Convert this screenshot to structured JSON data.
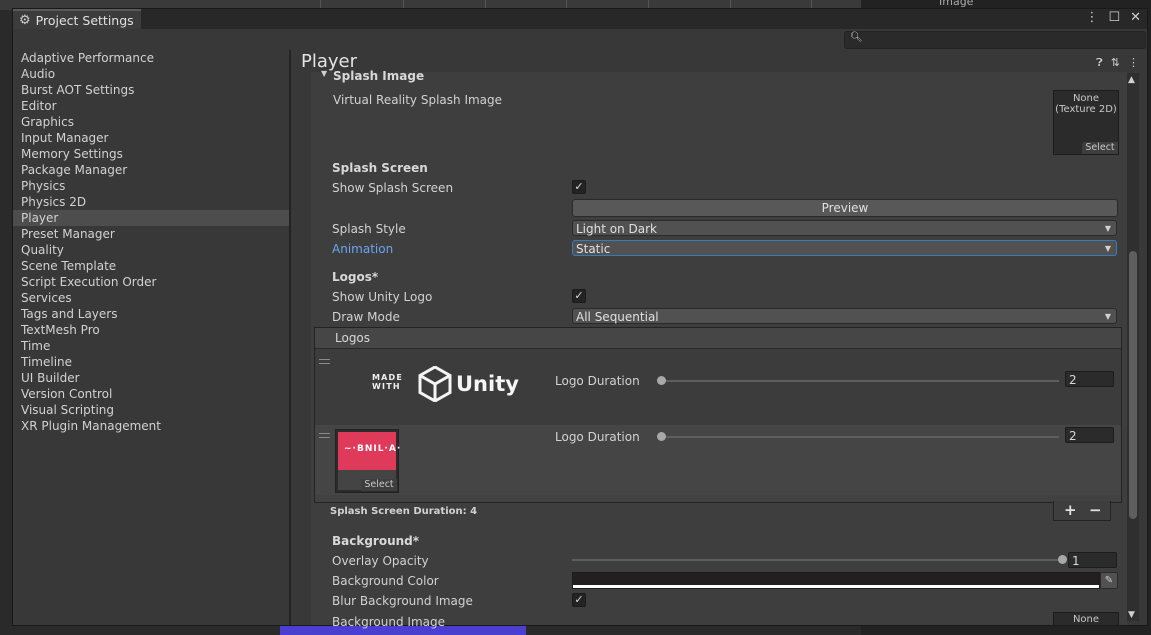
{
  "window": {
    "tab_title": "Project Settings"
  },
  "background_scene": {
    "hierarchy_label": "Image"
  },
  "sidebar": {
    "items": [
      {
        "label": "Adaptive Performance"
      },
      {
        "label": "Audio"
      },
      {
        "label": "Burst AOT Settings"
      },
      {
        "label": "Editor"
      },
      {
        "label": "Graphics"
      },
      {
        "label": "Input Manager"
      },
      {
        "label": "Memory Settings"
      },
      {
        "label": "Package Manager"
      },
      {
        "label": "Physics"
      },
      {
        "label": "Physics 2D"
      },
      {
        "label": "Player",
        "selected": true
      },
      {
        "label": "Preset Manager"
      },
      {
        "label": "Quality"
      },
      {
        "label": "Scene Template"
      },
      {
        "label": "Script Execution Order"
      },
      {
        "label": "Services"
      },
      {
        "label": "Tags and Layers"
      },
      {
        "label": "TextMesh Pro"
      },
      {
        "label": "Time"
      },
      {
        "label": "Timeline"
      },
      {
        "label": "UI Builder"
      },
      {
        "label": "Version Control"
      },
      {
        "label": "Visual Scripting"
      },
      {
        "label": "XR Plugin Management"
      }
    ]
  },
  "main": {
    "page_title": "Player",
    "splash_image": {
      "foldout": "Splash Image",
      "vr_label": "Virtual Reality Splash Image",
      "vr_value": "None (Texture 2D)",
      "select": "Select"
    },
    "splash_screen": {
      "header": "Splash Screen",
      "show_label": "Show Splash Screen",
      "show_checked": true,
      "preview_button": "Preview",
      "style_label": "Splash Style",
      "style_value": "Light on Dark",
      "animation_label": "Animation",
      "animation_value": "Static"
    },
    "logos": {
      "header": "Logos*",
      "show_unity_label": "Show Unity Logo",
      "show_unity_checked": true,
      "draw_mode_label": "Draw Mode",
      "draw_mode_value": "All Sequential",
      "list_header": "Logos",
      "entries": [
        {
          "duration_label": "Logo Duration",
          "duration": "2",
          "slider_fraction": 0.0,
          "made_with": "MADE\nWITH",
          "brand": "Unity"
        },
        {
          "duration_label": "Logo Duration",
          "duration": "2",
          "slider_fraction": 0.0,
          "select": "Select",
          "thumb_text": "~·BNIL·A·"
        }
      ],
      "add": "+",
      "remove": "−",
      "total_duration": "Splash Screen Duration: 4"
    },
    "background": {
      "header": "Background*",
      "overlay_label": "Overlay Opacity",
      "overlay_value": "1",
      "overlay_fraction": 1.0,
      "color_label": "Background Color",
      "color_hex": "#231F20",
      "blur_label": "Blur Background Image",
      "blur_checked": true,
      "image_label": "Background Image",
      "image_value": "None"
    }
  }
}
